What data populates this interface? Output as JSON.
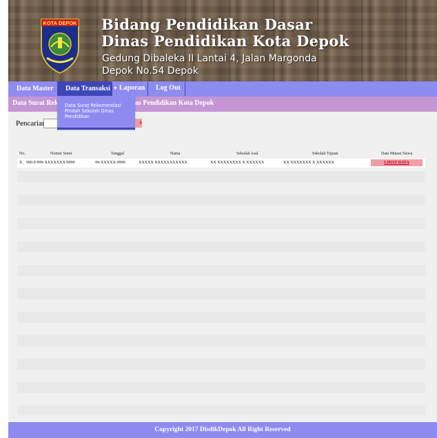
{
  "header": {
    "logo_text": "KOTA DEPOK",
    "title_line1": "Bidang Pendidikan Dasar",
    "title_line2": "Dinas Pendidikan Kota Depok",
    "address": "Gedung Dibaleka II Lantai 4, Jalan Margonda Depok No.54 Depok"
  },
  "nav": {
    "items": [
      {
        "label": "Data Master"
      },
      {
        "label": "Data Transaksi"
      },
      {
        "label": "Laporan"
      },
      {
        "label": "Log Out"
      }
    ],
    "dropdown_items": [
      "Data Surat Rekomendasi Pindah Sekolah Dinas Pendidikan"
    ]
  },
  "page": {
    "subheader_left": "Data Surat Reko",
    "subheader_right": "as Pendidikan Kota Depok"
  },
  "search": {
    "label": "Pencarian:",
    "value": "",
    "button_label": "k"
  },
  "table": {
    "columns": [
      "No.",
      "Nomor Surat",
      "Tanggal",
      "Nama",
      "Sekolah Asal",
      "Sekolah Tujuan",
      "Data Mutasi Siswa"
    ],
    "rows": [
      {
        "no": "X.",
        "nomor_surat": "999.9-999-XXXXXXX/9999",
        "tanggal": "99-XXXXX-9999",
        "nama": "XXXXX XXXXXXXXXXX",
        "sekolah_asal": "XX XXXXXXXX X XXXXXX",
        "sekolah_tujuan": "XX XXXXXXX X XXXXXX",
        "action_label": "LIHAT DATA"
      }
    ]
  },
  "footer": {
    "text": "Copyright 2017 DisdikDepok All Right Reserved"
  },
  "colors": {
    "nav_bg": "#8f8cf0",
    "nav_active": "#3f47b8",
    "subheader_bg": "#c596d4",
    "footer_bg": "#8e8bf0",
    "action_button_bg": "#f09fa6"
  }
}
